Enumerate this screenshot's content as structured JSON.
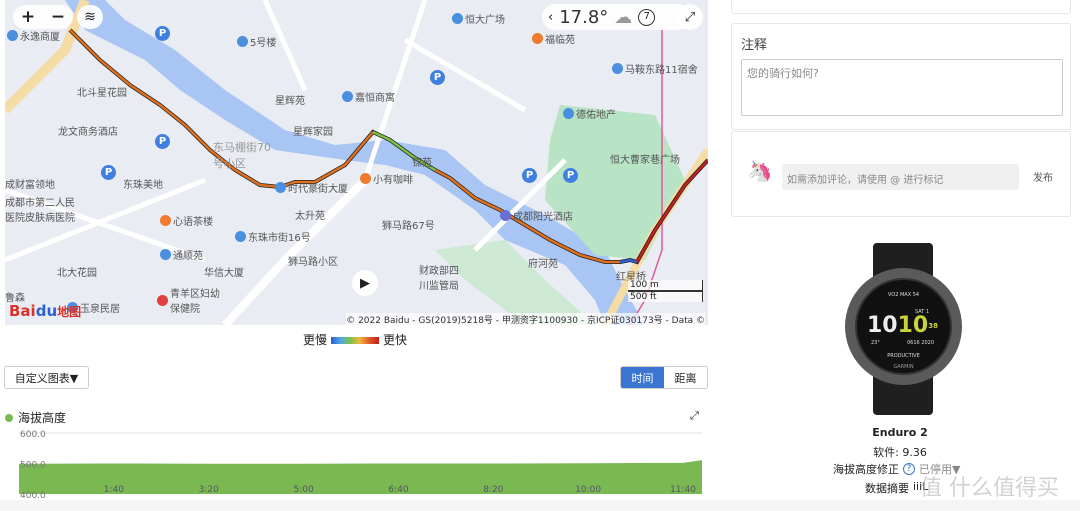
{
  "map": {
    "weather": {
      "temp": "17.8°",
      "wind": "7"
    },
    "zoom_in": "+",
    "zoom_out": "−",
    "labels": [
      "永逸商厦",
      "5号楼",
      "恒大广场",
      "福临苑",
      "马鞍东路11宿舍",
      "北斗星花园",
      "星辉苑",
      "嘉恒商寓",
      "德佑地产",
      "龙文商务酒店",
      "星辉家园",
      "东马棚街70号小区",
      "恒大曹家巷广场",
      "成财富领地",
      "东珠美地",
      "时代豪街大厦",
      "小有咖啡",
      "锦苑",
      "成都市第二人民医院皮肤病医院",
      "成都阳光酒店",
      "心语茶楼",
      "太升苑",
      "狮马路67号",
      "东珠市街16号",
      "通顺苑",
      "府河苑",
      "北大花园",
      "华信大厦",
      "狮马路小区",
      "财政部四川监管局",
      "红星桥",
      "青羊区妇幼保健院",
      "玉泉民居",
      "鲁森"
    ],
    "scale": {
      "metric": "100 m",
      "imperial": "500 ft"
    },
    "logo": "Baidu地图",
    "copyright": "© 2022 Baidu - GS(2019)5218号 - 甲测资字1100930 - 京ICP证030173号 - Data ©"
  },
  "legend": {
    "slow": "更慢",
    "fast": "更快"
  },
  "chart_controls": {
    "custom": "自定义图表▼",
    "time": "时间",
    "distance": "距离",
    "active": "时间"
  },
  "chart_data": {
    "type": "area",
    "title": "海拔高度",
    "color": "#7ab852",
    "y_ticks": [
      "600.0",
      "500.0",
      "400.0"
    ],
    "ylim": [
      400,
      600
    ],
    "x_ticks": [
      "1:40",
      "3:20",
      "5:00",
      "6:40",
      "8:20",
      "10:00",
      "11:40"
    ],
    "x": [
      "0:00",
      "1:40",
      "3:20",
      "5:00",
      "6:40",
      "8:20",
      "10:00",
      "11:40",
      "12:00"
    ],
    "values": [
      499,
      500,
      499,
      499,
      500,
      500,
      501,
      502,
      511
    ],
    "grid": true
  },
  "notes": {
    "title": "注释",
    "placeholder": "您的骑行如何?"
  },
  "comment": {
    "placeholder": "如需添加评论，请使用 @ 进行标记",
    "post": "发布"
  },
  "device": {
    "name": "Enduro 2",
    "software": "软件: 9.36",
    "elev_label": "海拔高度修正",
    "elev_value": "已停用▼",
    "summary_label": "数据摘要",
    "summary_value": "iiiL",
    "face": {
      "vo2": "VO2 MAX 54",
      "time": "1010",
      "sec": "38",
      "day": "SAT 1",
      "date": "0616 2020",
      "status": "PRODUCTIVE",
      "temp": "23°",
      "brand": "GARMIN"
    }
  },
  "watermark": "值 什么值得买"
}
